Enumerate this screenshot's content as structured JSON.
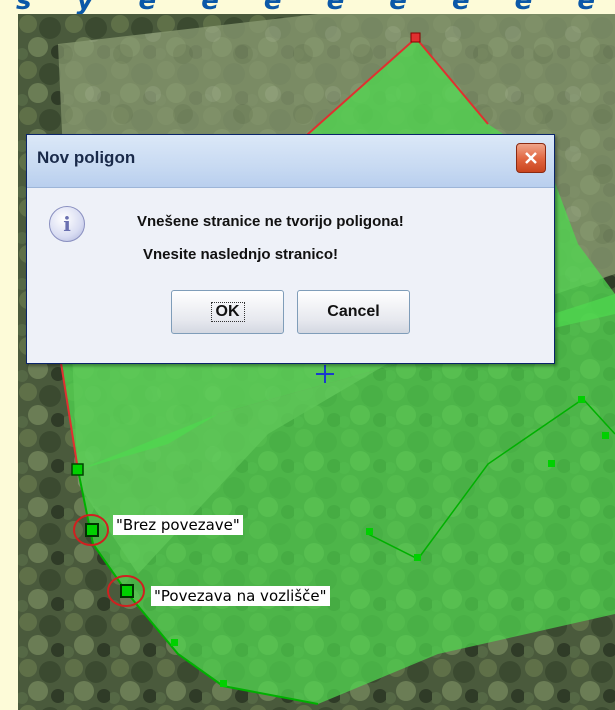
{
  "dialog": {
    "title": "Nov poligon",
    "message_line1": "Vnešene stranice ne tvorijo poligona!",
    "message_line2": "Vnesite naslednjo stranico!",
    "ok_label": "OK",
    "cancel_label": "Cancel",
    "icon": "info-icon"
  },
  "map": {
    "label_no_connection": "\"Brez povezave\"",
    "label_node_connection": "\"Povezava na vozlišče\""
  },
  "colors": {
    "polygon_fill": "#55d655",
    "polygon_edge_selected": "#e03030",
    "vertex": "#00c800",
    "highlight_circle": "#d02020",
    "cursor": "#1a3acd"
  }
}
